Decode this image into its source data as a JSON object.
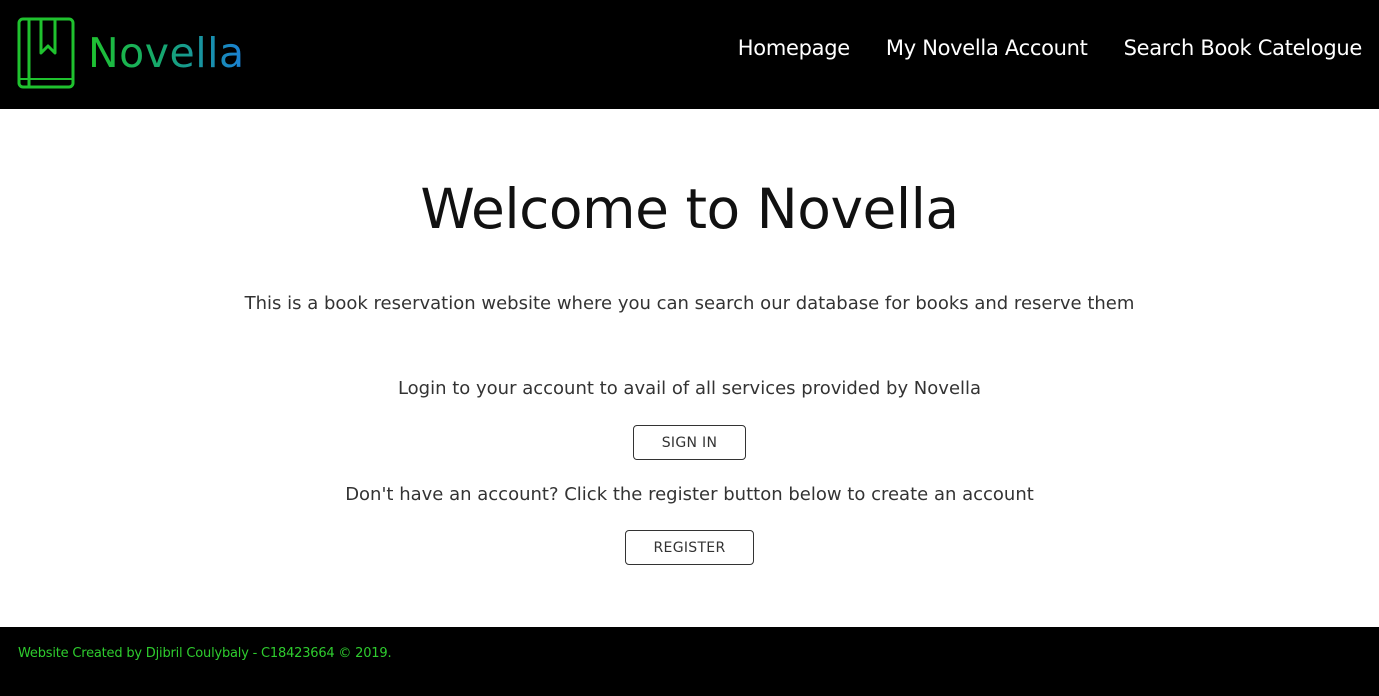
{
  "colors": {
    "header_bg": "#000000",
    "logo_green": "#1fc22e",
    "logo_blue": "#1a7fd6",
    "footer_text": "#2ecc2e"
  },
  "header": {
    "logo_icon": "bookmark-book-icon",
    "brand": "Novella",
    "nav": [
      {
        "label": "Homepage"
      },
      {
        "label": "My Novella Account"
      },
      {
        "label": "Search Book Catelogue"
      }
    ]
  },
  "main": {
    "title": "Welcome to Novella",
    "intro": "This is a book reservation website where you can search our database for books and reserve them",
    "login_text": "Login to your account to avail of all services provided by Novella",
    "signin_label": "SIGN IN",
    "register_text": "Don't have an account? Click the register button below to create an account",
    "register_label": "REGISTER"
  },
  "footer": {
    "text": "Website Created by Djibril Coulybaly - C18423664 © 2019."
  }
}
